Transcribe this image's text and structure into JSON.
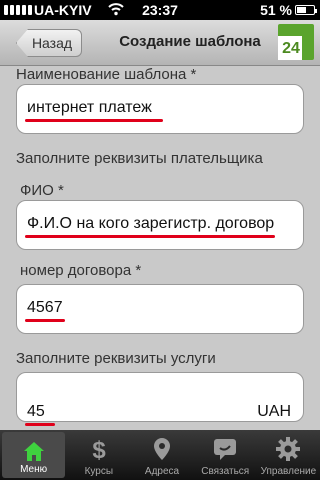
{
  "status_bar": {
    "carrier": "UA-KYIV",
    "time": "23:37",
    "battery": "51 %"
  },
  "nav": {
    "back_label": "Назад",
    "title": "Создание шаблона",
    "logo_text": "24"
  },
  "form": {
    "template_name_label": "Наименование шаблона *",
    "template_name_value": "интернет платеж",
    "payer_section": "Заполните реквизиты плательщика",
    "fio_label": "ФИО  *",
    "fio_value": "Ф.И.О на кого зарегистр. договор",
    "contract_label": "номер договора  *",
    "contract_value": "4567",
    "service_section": "Заполните реквизиты услуги",
    "amount_value": "45",
    "amount_currency": "UAH"
  },
  "tabs": [
    {
      "label": "Меню",
      "icon": "home-icon"
    },
    {
      "label": "Курсы",
      "icon": "dollar-icon"
    },
    {
      "label": "Адреса",
      "icon": "map-pin-icon"
    },
    {
      "label": "Связаться",
      "icon": "chat-icon"
    },
    {
      "label": "Управление",
      "icon": "gear-icon"
    }
  ],
  "colors": {
    "accent_green": "#5aa42d",
    "underline_red": "#e0001a"
  }
}
